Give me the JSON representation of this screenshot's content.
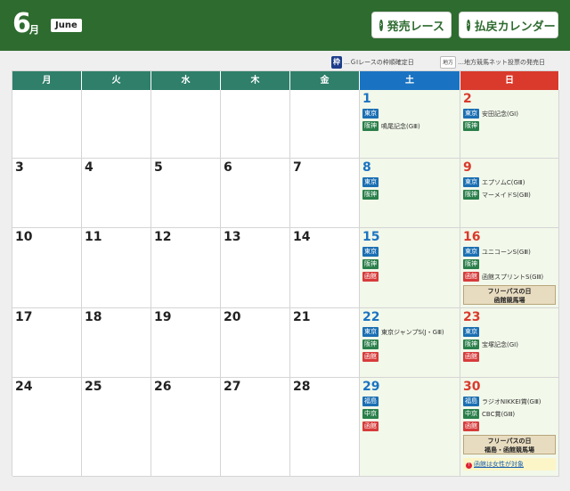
{
  "header": {
    "month_number": "6",
    "month_suffix": "月",
    "month_english": "June",
    "buttons": [
      {
        "label": "発売レース",
        "icon": "chevron-right-circle-icon"
      },
      {
        "label": "払戻カレンダー",
        "icon": "chevron-right-circle-icon"
      }
    ]
  },
  "legend": [
    {
      "badge": "枠",
      "text": "…ＧⅠレースの枠順確定日"
    },
    {
      "badge": "地方",
      "text": "…地方競馬ネット投票の発売日"
    }
  ],
  "weekdays": [
    "月",
    "火",
    "水",
    "木",
    "金",
    "土",
    "日"
  ],
  "weeks": [
    [
      {
        "day": ""
      },
      {
        "day": ""
      },
      {
        "day": ""
      },
      {
        "day": ""
      },
      {
        "day": ""
      },
      {
        "day": "1",
        "races": [
          {
            "venue": "東京",
            "color": "#1b6fb3",
            "name": ""
          },
          {
            "venue": "阪神",
            "color": "#2a7f4a",
            "name": "鳴尾記念(GⅢ)"
          }
        ]
      },
      {
        "day": "2",
        "races": [
          {
            "venue": "東京",
            "color": "#1b6fb3",
            "name": "安田記念(GⅠ)"
          },
          {
            "venue": "阪神",
            "color": "#2a7f4a",
            "name": ""
          }
        ]
      }
    ],
    [
      {
        "day": "3"
      },
      {
        "day": "4"
      },
      {
        "day": "5"
      },
      {
        "day": "6"
      },
      {
        "day": "7"
      },
      {
        "day": "8",
        "races": [
          {
            "venue": "東京",
            "color": "#1b6fb3",
            "name": ""
          },
          {
            "venue": "阪神",
            "color": "#2a7f4a",
            "name": ""
          }
        ]
      },
      {
        "day": "9",
        "races": [
          {
            "venue": "東京",
            "color": "#1b6fb3",
            "name": "エプソムC(GⅢ)"
          },
          {
            "venue": "阪神",
            "color": "#2a7f4a",
            "name": "マーメイドS(GⅢ)"
          }
        ]
      }
    ],
    [
      {
        "day": "10"
      },
      {
        "day": "11"
      },
      {
        "day": "12"
      },
      {
        "day": "13"
      },
      {
        "day": "14"
      },
      {
        "day": "15",
        "races": [
          {
            "venue": "東京",
            "color": "#1b6fb3",
            "name": ""
          },
          {
            "venue": "阪神",
            "color": "#2a7f4a",
            "name": ""
          },
          {
            "venue": "函館",
            "color": "#d73b3b",
            "name": ""
          }
        ]
      },
      {
        "day": "16",
        "races": [
          {
            "venue": "東京",
            "color": "#1b6fb3",
            "name": "ユニコーンS(GⅢ)"
          },
          {
            "venue": "阪神",
            "color": "#2a7f4a",
            "name": ""
          },
          {
            "venue": "函館",
            "color": "#d73b3b",
            "name": "函館スプリントS(GⅢ)"
          }
        ],
        "freepass": [
          "フリーパスの日",
          "函館競馬場"
        ]
      }
    ],
    [
      {
        "day": "17"
      },
      {
        "day": "18"
      },
      {
        "day": "19"
      },
      {
        "day": "20"
      },
      {
        "day": "21"
      },
      {
        "day": "22",
        "races": [
          {
            "venue": "東京",
            "color": "#1b6fb3",
            "name": "東京ジャンプS(J・GⅢ)"
          },
          {
            "venue": "阪神",
            "color": "#2a7f4a",
            "name": ""
          },
          {
            "venue": "函館",
            "color": "#d73b3b",
            "name": ""
          }
        ]
      },
      {
        "day": "23",
        "races": [
          {
            "venue": "東京",
            "color": "#1b6fb3",
            "name": ""
          },
          {
            "venue": "阪神",
            "color": "#2a7f4a",
            "name": "宝塚記念(GⅠ)"
          },
          {
            "venue": "函館",
            "color": "#d73b3b",
            "name": ""
          }
        ]
      }
    ],
    [
      {
        "day": "24"
      },
      {
        "day": "25"
      },
      {
        "day": "26"
      },
      {
        "day": "27"
      },
      {
        "day": "28"
      },
      {
        "day": "29",
        "races": [
          {
            "venue": "福島",
            "color": "#1b6fb3",
            "name": ""
          },
          {
            "venue": "中京",
            "color": "#2a7f4a",
            "name": ""
          },
          {
            "venue": "函館",
            "color": "#d73b3b",
            "name": ""
          }
        ]
      },
      {
        "day": "30",
        "races": [
          {
            "venue": "福島",
            "color": "#1b6fb3",
            "name": "ラジオNIKKEI賞(GⅢ)"
          },
          {
            "venue": "中京",
            "color": "#2a7f4a",
            "name": "CBC賞(GⅢ)"
          },
          {
            "venue": "函館",
            "color": "#d73b3b",
            "name": ""
          }
        ],
        "freepass": [
          "フリーパスの日",
          "福島・函館競馬場"
        ],
        "note": {
          "link": "函館は女性が対象"
        }
      }
    ]
  ]
}
